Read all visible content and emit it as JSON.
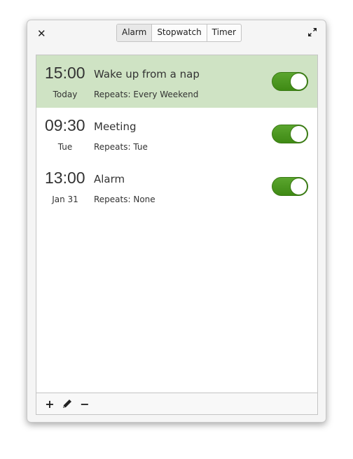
{
  "window": {
    "close_icon": "close-icon",
    "maximize_icon": "maximize-icon"
  },
  "tabs": [
    {
      "label": "Alarm",
      "active": true
    },
    {
      "label": "Stopwatch"
    },
    {
      "label": "Timer"
    }
  ],
  "alarms": [
    {
      "time": "15:00",
      "date": "Today",
      "name": "Wake up from a nap",
      "repeats": "Repeats: Every Weekend",
      "enabled": true
    },
    {
      "time": "09:30",
      "date": "Tue",
      "name": "Meeting",
      "repeats": "Repeats: Tue",
      "enabled": true
    },
    {
      "time": "13:00",
      "date": "Jan 31",
      "name": "Alarm",
      "repeats": "Repeats: None",
      "enabled": true
    }
  ],
  "toolbar": {
    "add": "+",
    "minus": "−"
  }
}
